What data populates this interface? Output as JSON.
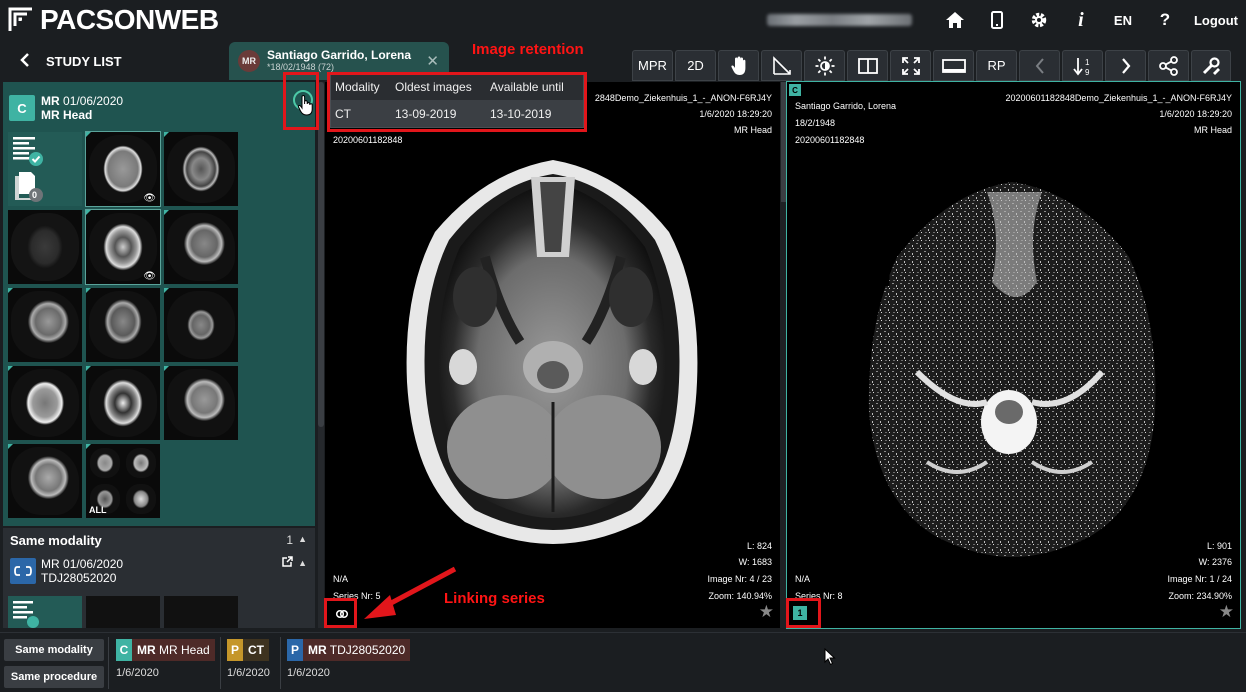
{
  "app": {
    "logo_text": "PACSONWEB"
  },
  "header": {
    "language": "EN",
    "logout_label": "Logout",
    "icons": [
      "home-icon",
      "mobile-icon",
      "gear-icon",
      "info-icon",
      "help-icon"
    ]
  },
  "nav": {
    "study_list_label": "STUDY LIST"
  },
  "patient_tab": {
    "modality_badge": "MR",
    "name": "Santiago Garrido, Lorena",
    "dob": "*18/02/1948 (72)"
  },
  "retention_popup": {
    "headers": [
      "Modality",
      "Oldest images",
      "Available until"
    ],
    "rows": [
      [
        "CT",
        "13-09-2019",
        "13-10-2019"
      ]
    ]
  },
  "annotations": {
    "image_retention": "Image retention",
    "linking_series": "Linking series"
  },
  "toolbar": {
    "mpr": "MPR",
    "two_d": "2D",
    "rp": "RP"
  },
  "study": {
    "badge": "C",
    "modality": "MR",
    "date": "01/06/2020",
    "description": "MR Head",
    "doc_count": "0",
    "all_label": "ALL"
  },
  "same_modality": {
    "title": "Same modality",
    "count": "1",
    "modality": "MR",
    "date": "01/06/2020",
    "description": "TDJ28052020"
  },
  "viewport_left": {
    "name_partial": "2848Demo_Ziekenhuis_1_-_ANON-F6RJ4Y",
    "datetime": "1/6/2020 18:29:20",
    "study_desc": "MR Head",
    "accession": "20200601182848",
    "level": "L: 824",
    "window": "W: 1683",
    "na": "N/A",
    "image_nr": "Image Nr: 4 / 23",
    "series": "Series Nr: 5",
    "zoom": "Zoom: 140.94%"
  },
  "viewport_right": {
    "badge": "C",
    "patient": "Santiago Garrido, Lorena",
    "dob": "18/2/1948",
    "accession": "20200601182848",
    "name_id": "20200601182848Demo_Ziekenhuis_1_-_ANON-F6RJ4Y",
    "datetime": "1/6/2020 18:29:20",
    "study_desc": "MR Head",
    "level": "L: 901",
    "window": "W: 2376",
    "na": "N/A",
    "image_nr": "Image Nr: 1 / 24",
    "series": "Series Nr: 8",
    "zoom": "Zoom: 234.90%",
    "link_badge": "1"
  },
  "bottom": {
    "same_modality_btn": "Same modality",
    "same_procedure_btn": "Same procedure",
    "chips": [
      {
        "badge": "C",
        "modality": "MR",
        "desc": "MR Head",
        "date": "1/6/2020",
        "color": "#3fb3a3"
      },
      {
        "badge": "P",
        "modality": "CT",
        "desc": "",
        "date": "1/6/2020",
        "color": "#c5962a"
      },
      {
        "badge": "P",
        "modality": "MR",
        "desc": "TDJ28052020",
        "date": "1/6/2020",
        "color": "#2b67a8"
      }
    ]
  }
}
